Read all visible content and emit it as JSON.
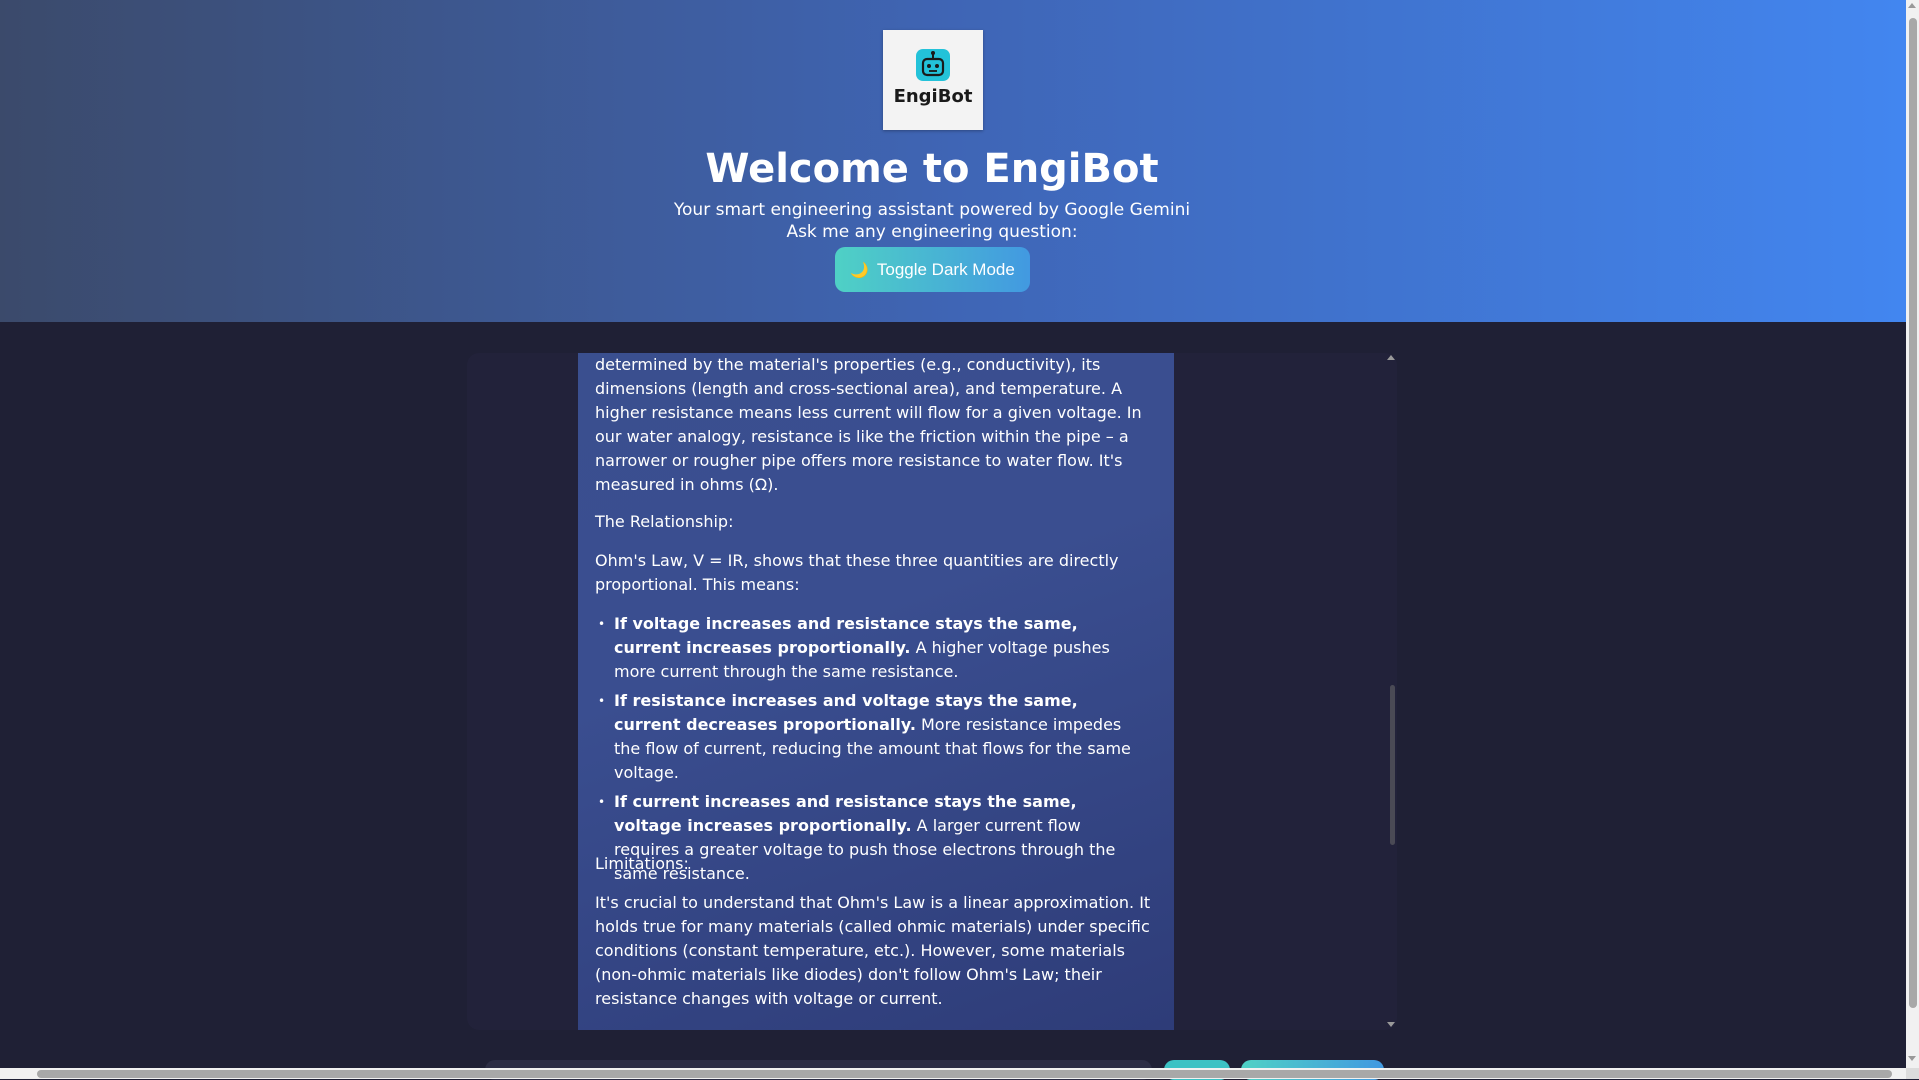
{
  "logo": {
    "text": "EngiBot",
    "icon": "robot-icon"
  },
  "header": {
    "title": "Welcome to EngiBot",
    "subtitle": "Your smart engineering assistant powered by Google Gemini",
    "prompt": "Ask me any engineering question:",
    "toggle_icon": "🌙",
    "toggle_label": "Toggle Dark Mode"
  },
  "message": {
    "intro": "determined by the material's properties (e.g., conductivity), its dimensions (length and cross-sectional area), and temperature. A higher resistance means less current will flow for a given voltage. In our water analogy, resistance is like the friction within the pipe – a narrower or rougher pipe offers more resistance to water flow. It's measured in ohms (Ω).",
    "relationship_heading": "The Relationship:",
    "relationship_text": "Ohm's Law, V = IR, shows that these three quantities are directly proportional. This means:",
    "bullets": [
      {
        "bold": "If voltage increases and resistance stays the same, current increases proportionally.",
        "text": " A higher voltage pushes more current through the same resistance."
      },
      {
        "bold": "If resistance increases and voltage stays the same, current decreases proportionally.",
        "text": " More resistance impedes the flow of current, reducing the amount that flows for the same voltage."
      },
      {
        "bold": "If current increases and resistance stays the same, voltage increases proportionally.",
        "text": " A larger current flow requires a greater voltage to push those electrons through the same resistance."
      }
    ],
    "limitations_heading": "Limitations:",
    "limitations_text": "It's crucial to understand that Ohm's Law is a linear approximation. It holds true for many materials (called ohmic materials) under specific conditions (constant temperature, etc.). However, some materials (non-ohmic materials like diodes) don't follow Ohm's Law; their resistance changes with voltage or current."
  },
  "colors": {
    "header_gradient_start": "#3b4a6b",
    "header_gradient_end": "#4286f0",
    "page_background": "#1f2035",
    "accent_teal": "#4fd1c5",
    "accent_blue": "#4299e1"
  }
}
